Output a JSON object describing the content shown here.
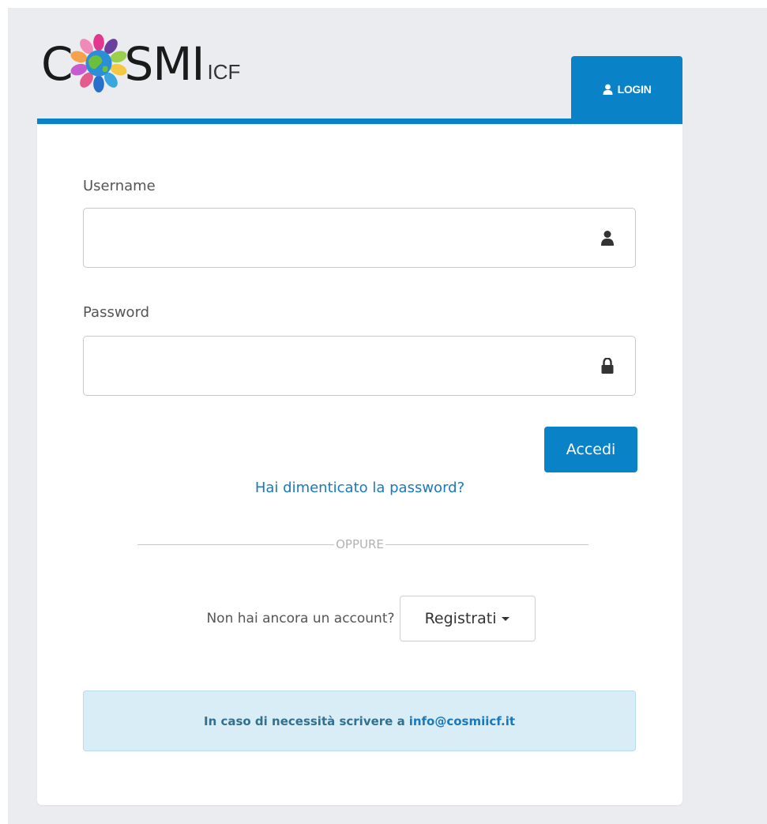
{
  "logo": {
    "left_letter": "C",
    "right_letters": "SMI",
    "suffix": "ICF"
  },
  "tab": {
    "label": "LOGIN",
    "icon": "user-icon"
  },
  "form": {
    "username_label": "Username",
    "username_value": "",
    "username_icon": "user-icon",
    "password_label": "Password",
    "password_value": "",
    "password_icon": "lock-icon",
    "submit_label": "Accedi",
    "forgot_link": "Hai dimenticato la password?"
  },
  "divider": {
    "text": "OPPURE"
  },
  "register": {
    "prompt": "Non hai ancora un account?",
    "button_label": "Registrati"
  },
  "info": {
    "text": "In caso di necessità scrivere a",
    "email": "info@cosmiicf.it"
  },
  "colors": {
    "primary": "#0a82c8",
    "page_background": "#ebecef",
    "link": "#1a78bf",
    "info_background": "#d9edf7"
  }
}
